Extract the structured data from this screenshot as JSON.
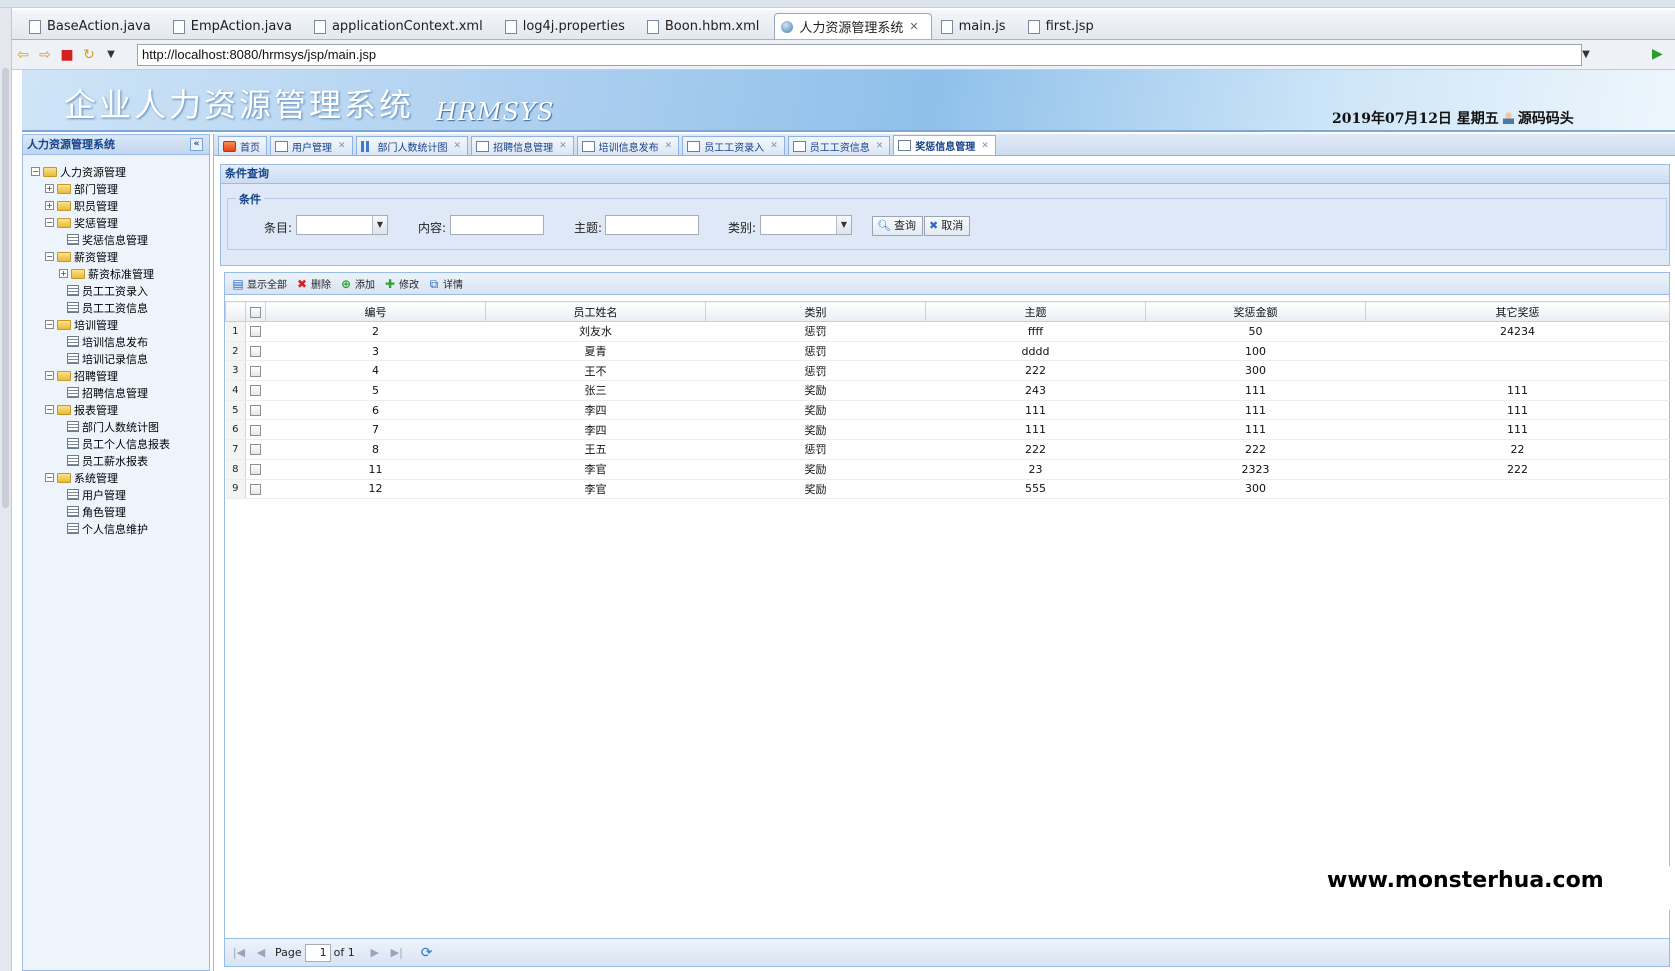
{
  "ide": {
    "tabs": [
      {
        "label": "BaseAction.java",
        "icon": "java-file-icon"
      },
      {
        "label": "EmpAction.java",
        "icon": "java-file-icon"
      },
      {
        "label": "applicationContext.xml",
        "icon": "xml-file-icon"
      },
      {
        "label": "log4j.properties",
        "icon": "properties-file-icon"
      },
      {
        "label": "Boon.hbm.xml",
        "icon": "xml-file-icon"
      },
      {
        "label": "人力资源管理系统",
        "icon": "globe-icon",
        "active": true
      },
      {
        "label": "main.js",
        "icon": "js-file-icon"
      },
      {
        "label": "first.jsp",
        "icon": "jsp-file-icon"
      }
    ]
  },
  "browser": {
    "url": "http://localhost:8080/hrmsys/jsp/main.jsp"
  },
  "header": {
    "title": "企业人力资源管理系统",
    "subtitle": "HRMSYS",
    "date": "2019年07月12日 星期五",
    "user": "源码码头"
  },
  "sidebar": {
    "title": "人力资源管理系统",
    "tree": [
      {
        "label": "人力资源管理",
        "level": 0,
        "type": "folder",
        "expander": "minus"
      },
      {
        "label": "部门管理",
        "level": 1,
        "type": "folder",
        "expander": "plus"
      },
      {
        "label": "职员管理",
        "level": 1,
        "type": "folder",
        "expander": "plus"
      },
      {
        "label": "奖惩管理",
        "level": 1,
        "type": "folder",
        "expander": "minus"
      },
      {
        "label": "奖惩信息管理",
        "level": 2,
        "type": "leaf"
      },
      {
        "label": "薪资管理",
        "level": 1,
        "type": "folder",
        "expander": "minus"
      },
      {
        "label": "薪资标准管理",
        "level": 2,
        "type": "folder",
        "expander": "plus"
      },
      {
        "label": "员工工资录入",
        "level": 2,
        "type": "leaf"
      },
      {
        "label": "员工工资信息",
        "level": 2,
        "type": "leaf"
      },
      {
        "label": "培训管理",
        "level": 1,
        "type": "folder",
        "expander": "minus"
      },
      {
        "label": "培训信息发布",
        "level": 2,
        "type": "leaf"
      },
      {
        "label": "培训记录信息",
        "level": 2,
        "type": "leaf"
      },
      {
        "label": "招聘管理",
        "level": 1,
        "type": "folder",
        "expander": "minus"
      },
      {
        "label": "招聘信息管理",
        "level": 2,
        "type": "leaf"
      },
      {
        "label": "报表管理",
        "level": 1,
        "type": "folder",
        "expander": "minus"
      },
      {
        "label": "部门人数统计图",
        "level": 2,
        "type": "leaf"
      },
      {
        "label": "员工个人信息报表",
        "level": 2,
        "type": "leaf"
      },
      {
        "label": "员工薪水报表",
        "level": 2,
        "type": "leaf"
      },
      {
        "label": "系统管理",
        "level": 1,
        "type": "folder",
        "expander": "minus"
      },
      {
        "label": "用户管理",
        "level": 2,
        "type": "leaf"
      },
      {
        "label": "角色管理",
        "level": 2,
        "type": "leaf"
      },
      {
        "label": "个人信息维护",
        "level": 2,
        "type": "leaf"
      }
    ]
  },
  "tabs": [
    {
      "label": "首页",
      "icon": "home-icon",
      "closable": false
    },
    {
      "label": "用户管理",
      "icon": "user-admin-icon",
      "closable": true
    },
    {
      "label": "部门人数统计图",
      "icon": "bar-chart-icon",
      "closable": true
    },
    {
      "label": "招聘信息管理",
      "icon": "list-icon",
      "closable": true
    },
    {
      "label": "培训信息发布",
      "icon": "list-icon",
      "closable": true
    },
    {
      "label": "员工工资录入",
      "icon": "edit-icon",
      "closable": true
    },
    {
      "label": "员工工资信息",
      "icon": "table-icon",
      "closable": true
    },
    {
      "label": "奖惩信息管理",
      "icon": "document-icon",
      "closable": true,
      "active": true
    }
  ],
  "search": {
    "panel_title": "条件查询",
    "legend": "条件",
    "item_label": "条目:",
    "content_label": "内容:",
    "subject_label": "主题:",
    "type_label": "类别:",
    "item_value": "",
    "content_value": "",
    "subject_value": "",
    "type_value": "",
    "query_button": "查询",
    "cancel_button": "取消"
  },
  "toolbar": {
    "show_all": "显示全部",
    "delete": "删除",
    "add": "添加",
    "edit": "修改",
    "detail": "详情"
  },
  "table": {
    "columns": [
      "编号",
      "员工姓名",
      "类别",
      "主题",
      "奖惩金额",
      "其它奖惩"
    ],
    "rows": [
      {
        "rownum": "1",
        "id": "2",
        "name": "刘友水",
        "type": "惩罚",
        "subject": "ffff",
        "amount": "50",
        "other": "24234"
      },
      {
        "rownum": "2",
        "id": "3",
        "name": "夏青",
        "type": "惩罚",
        "subject": "dddd",
        "amount": "100",
        "other": ""
      },
      {
        "rownum": "3",
        "id": "4",
        "name": "王不",
        "type": "惩罚",
        "subject": "222",
        "amount": "300",
        "other": ""
      },
      {
        "rownum": "4",
        "id": "5",
        "name": "张三",
        "type": "奖励",
        "subject": "243",
        "amount": "111",
        "other": "111"
      },
      {
        "rownum": "5",
        "id": "6",
        "name": "李四",
        "type": "奖励",
        "subject": "111",
        "amount": "111",
        "other": "111"
      },
      {
        "rownum": "6",
        "id": "7",
        "name": "李四",
        "type": "奖励",
        "subject": "111",
        "amount": "111",
        "other": "111"
      },
      {
        "rownum": "7",
        "id": "8",
        "name": "王五",
        "type": "惩罚",
        "subject": "222",
        "amount": "222",
        "other": "22"
      },
      {
        "rownum": "8",
        "id": "11",
        "name": "李官",
        "type": "奖励",
        "subject": "23",
        "amount": "2323",
        "other": "222"
      },
      {
        "rownum": "9",
        "id": "12",
        "name": "李官",
        "type": "奖励",
        "subject": "555",
        "amount": "300",
        "other": ""
      }
    ]
  },
  "pager": {
    "page_label": "Page",
    "page_value": "1",
    "of_label": "of 1"
  },
  "watermark": "www.monsterhua.com"
}
